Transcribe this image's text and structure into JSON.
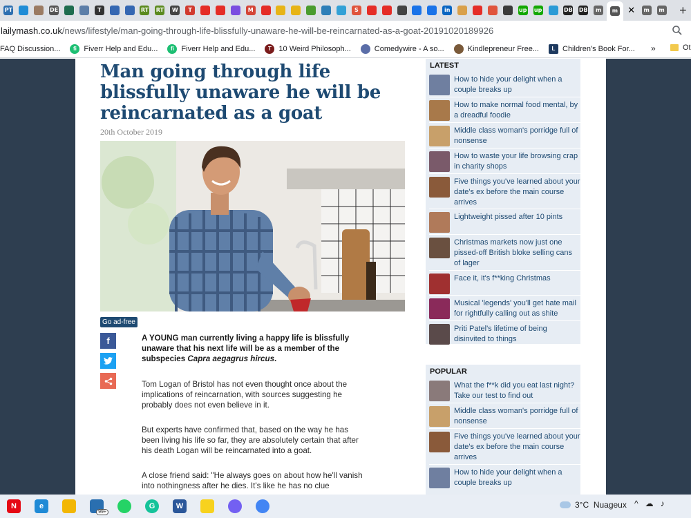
{
  "browser": {
    "tabs": [
      {
        "label": "PT",
        "color": "#2d6fb0"
      },
      {
        "label": "",
        "color": "#1f8cd6"
      },
      {
        "label": "",
        "color": "#9b7b63"
      },
      {
        "label": "DE",
        "color": "#555555"
      },
      {
        "label": "",
        "color": "#1f6d4f"
      },
      {
        "label": "",
        "color": "#5c7ea8"
      },
      {
        "label": "T",
        "color": "#333333"
      },
      {
        "label": "",
        "color": "#3567b2"
      },
      {
        "label": "",
        "color": "#3567b2"
      },
      {
        "label": "RT",
        "color": "#5b8a1f"
      },
      {
        "label": "RT",
        "color": "#5b8a1f"
      },
      {
        "label": "W",
        "color": "#444444"
      },
      {
        "label": "T",
        "color": "#d13b30"
      },
      {
        "label": "",
        "color": "#e52d27"
      },
      {
        "label": "",
        "color": "#e52d27"
      },
      {
        "label": "",
        "color": "#7a4de0"
      },
      {
        "label": "M",
        "color": "#d44638"
      },
      {
        "label": "",
        "color": "#e52d27"
      },
      {
        "label": "",
        "color": "#e7b416"
      },
      {
        "label": "",
        "color": "#e7b416"
      },
      {
        "label": "",
        "color": "#4a9c2e"
      },
      {
        "label": "",
        "color": "#2e7fb8"
      },
      {
        "label": "",
        "color": "#33a1d6"
      },
      {
        "label": "S",
        "color": "#e0543c"
      },
      {
        "label": "",
        "color": "#e52d27"
      },
      {
        "label": "",
        "color": "#e52d27"
      },
      {
        "label": "",
        "color": "#444444"
      },
      {
        "label": "",
        "color": "#1a73e8"
      },
      {
        "label": "",
        "color": "#1a73e8"
      },
      {
        "label": "in",
        "color": "#0a66c2"
      },
      {
        "label": "",
        "color": "#d9a04a"
      },
      {
        "label": "",
        "color": "#e52d27"
      },
      {
        "label": "",
        "color": "#e0543c"
      },
      {
        "label": "",
        "color": "#3b3b3b"
      },
      {
        "label": "up",
        "color": "#14a800"
      },
      {
        "label": "up",
        "color": "#14a800"
      },
      {
        "label": "",
        "color": "#2b9bd6"
      },
      {
        "label": "DB",
        "color": "#222222"
      },
      {
        "label": "DB",
        "color": "#222222"
      },
      {
        "label": "m",
        "color": "#666666"
      }
    ],
    "active_tab": {
      "label": "m",
      "close_glyph": "✕"
    },
    "after_tabs": [
      {
        "label": "m"
      },
      {
        "label": "m"
      }
    ],
    "new_tab_glyph": "+",
    "url_host": "lailymash.co.uk",
    "url_path": "/news/lifestyle/man-going-through-life-blissfully-unaware-he-will-be-reincarnated-as-a-goat-20191020189926",
    "bookmarks": [
      {
        "label": "FAQ Discussion...",
        "icon": "none"
      },
      {
        "label": "Fiverr Help and Edu...",
        "icon": "fiverr"
      },
      {
        "label": "Fiverr Help and Edu...",
        "icon": "fiverr"
      },
      {
        "label": "10 Weird Philosoph...",
        "icon": "t"
      },
      {
        "label": "Comedywire - A so...",
        "icon": "globe"
      },
      {
        "label": "Kindlepreneur Free...",
        "icon": "k"
      },
      {
        "label": "Children's Book For...",
        "icon": "l"
      }
    ],
    "bookmarks_more": "»",
    "other_bookmarks": "Ot"
  },
  "article": {
    "title": "Man going through life blissfully unaware he will be reincarnated as a goat",
    "date": "20th October 2019",
    "ad_free_label": "Go ad-free",
    "share": {
      "facebook": "f",
      "twitter": "t",
      "share": "<"
    },
    "lede_start": "A YOUNG man currently living a happy life is blissfully unaware that his next life will be as a member of the subspecies ",
    "lede_em": "Capra aegagrus hircus",
    "lede_end": ".",
    "paragraphs": [
      "Tom Logan of Bristol has not even thought once about the implications of reincarnation, with sources suggesting he probably does not even believe in it.",
      "But experts have confirmed that, based on the way he has been living his life so far, they are absolutely certain that after his death Logan will be reincarnated into a goat.",
      "A close friend said: \"He always goes on about how he'll vanish into nothingness after he dies. It's like he has no clue"
    ]
  },
  "sidebar": {
    "latest_heading": "LATEST",
    "latest": [
      {
        "title": "How to hide your delight when a couple breaks up",
        "thumb": "#6f7fa0"
      },
      {
        "title": "How to make normal food mental, by a dreadful foodie",
        "thumb": "#a8794a"
      },
      {
        "title": "Middle class woman's porridge full of nonsense",
        "thumb": "#c8a06a"
      },
      {
        "title": "How to waste your life browsing crap in charity shops",
        "thumb": "#7a5a6a"
      },
      {
        "title": "Five things you've learned about your date's ex before the main course arrives",
        "thumb": "#8a5a3a"
      },
      {
        "title": "Lightweight pissed after 10 pints",
        "thumb": "#b07a5a"
      },
      {
        "title": "Christmas markets now just one pissed-off British bloke selling cans of lager",
        "thumb": "#6a5040"
      },
      {
        "title": "Face it, it's f**king Christmas",
        "thumb": "#a03030"
      },
      {
        "title": "Musical 'legends' you'll get hate mail for rightfully calling out as shite",
        "thumb": "#8a2a5a"
      },
      {
        "title": "Priti Patel's lifetime of being disinvited to things",
        "thumb": "#5a4a4a"
      }
    ],
    "popular_heading": "POPULAR",
    "popular": [
      {
        "title": "What the f**k did you eat last night? Take our test to find out",
        "thumb": "#8a7a7a"
      },
      {
        "title": "Middle class woman's porridge full of nonsense",
        "thumb": "#c8a06a"
      },
      {
        "title": "Five things you've learned about your date's ex before the main course arrives",
        "thumb": "#8a5a3a"
      },
      {
        "title": "How to hide your delight when a couple breaks up",
        "thumb": "#6f7fa0"
      }
    ]
  },
  "taskbar": {
    "apps": [
      {
        "name": "netflix",
        "label": "N",
        "color": "#e50914"
      },
      {
        "name": "edge",
        "label": "e",
        "color": "#1f8ad6"
      },
      {
        "name": "file-explorer",
        "label": "",
        "color": "#f2b705"
      },
      {
        "name": "mail",
        "label": "",
        "color": "#2a6fb0",
        "badge": "99+"
      },
      {
        "name": "whatsapp",
        "label": "",
        "color": "#25d366"
      },
      {
        "name": "grammarly",
        "label": "G",
        "color": "#15c39a"
      },
      {
        "name": "word",
        "label": "W",
        "color": "#2b579a"
      },
      {
        "name": "sticky-notes",
        "label": "",
        "color": "#f7d21e"
      },
      {
        "name": "viber",
        "label": "",
        "color": "#7360f2"
      },
      {
        "name": "chrome",
        "label": "",
        "color": "#4285f4"
      }
    ],
    "weather_temp": "3°C",
    "weather_desc": "Nuageux",
    "tray": [
      "^",
      "☁",
      "♪"
    ]
  }
}
